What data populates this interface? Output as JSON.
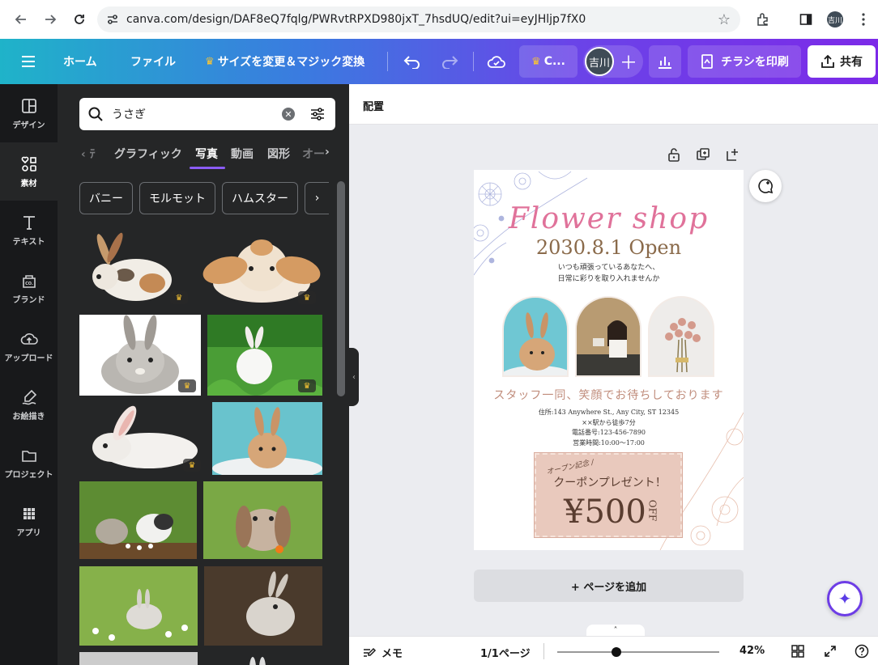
{
  "browser": {
    "url": "canva.com/design/DAF8eQ7fqlg/PWRvtRPXD980jxT_7hsdUQ/edit?ui=eyJHljp7fX0",
    "avatar": "吉川"
  },
  "header": {
    "home": "ホーム",
    "file": "ファイル",
    "resize": "サイズを変更＆マジック変換",
    "crown_btn": "C...",
    "user": "吉川",
    "print": "チラシを印刷",
    "share": "共有"
  },
  "rail": [
    {
      "label": "デザイン",
      "icon": "design-icon"
    },
    {
      "label": "素材",
      "icon": "elements-icon"
    },
    {
      "label": "テキスト",
      "icon": "text-icon"
    },
    {
      "label": "ブランド",
      "icon": "brand-icon"
    },
    {
      "label": "アップロード",
      "icon": "upload-icon"
    },
    {
      "label": "お絵描き",
      "icon": "draw-icon"
    },
    {
      "label": "プロジェクト",
      "icon": "folder-icon"
    },
    {
      "label": "アプリ",
      "icon": "apps-icon"
    }
  ],
  "panel": {
    "search_value": "うさぎ",
    "tabs": [
      "グラフィック",
      "写真",
      "動画",
      "図形",
      "オー"
    ],
    "chips": [
      "バニー",
      "モルモット",
      "ハムスター"
    ]
  },
  "editor": {
    "toolbar_label": "配置",
    "add_page": "+ ページを追加",
    "memo": "メモ",
    "pages": "1/1ページ",
    "zoom": "42%"
  },
  "flyer": {
    "title": "Flower shop",
    "date": "2030.8.1  Open",
    "sub1": "いつも頑張っているあなたへ、",
    "sub2": "日常に彩りを取り入れませんか",
    "staff": "スタッフ一同、笑顔でお待ちしております",
    "info1": "住所:143 Anywhere St., Any City, ST 12345",
    "info2": "××駅から徒歩7分",
    "info3": "電話番号:123-456-7890",
    "info4": "営業時間:10:00〜17:00",
    "coupon_small": "オープン記念 /",
    "coupon_main": "クーポンプレゼント！",
    "coupon_price": "¥500",
    "coupon_off": "OFF"
  },
  "colors": {
    "accent": "#8b5cf6",
    "rail_bg": "#18191b",
    "panel_bg": "#252627",
    "title_pink": "#e0729a",
    "coupon_bg": "#e9c9bd"
  }
}
